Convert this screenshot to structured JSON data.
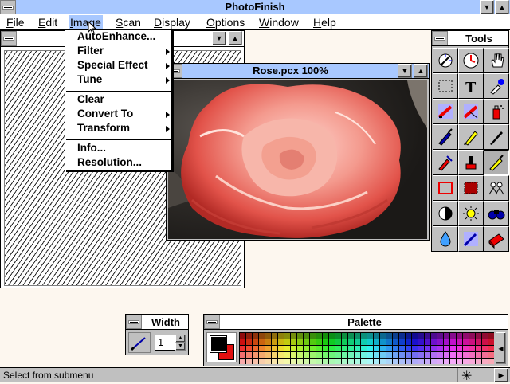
{
  "app": {
    "title": "PhotoFinish"
  },
  "menubar": [
    {
      "label": "File",
      "key": "F",
      "rest": "ile"
    },
    {
      "label": "Edit",
      "key": "E",
      "rest": "dit"
    },
    {
      "label": "Image",
      "key": "I",
      "rest": "mage"
    },
    {
      "label": "Scan",
      "key": "S",
      "rest": "can"
    },
    {
      "label": "Display",
      "key": "D",
      "rest": "isplay"
    },
    {
      "label": "Options",
      "key": "O",
      "rest": "ptions"
    },
    {
      "label": "Window",
      "key": "W",
      "rest": "indow"
    },
    {
      "label": "Help",
      "key": "H",
      "rest": "elp"
    }
  ],
  "image_menu": {
    "items": [
      {
        "label": "AutoEnhance..."
      },
      {
        "label": "Filter"
      },
      {
        "label": "Special Effect"
      },
      {
        "label": "Tune"
      },
      {
        "label": "Clear"
      },
      {
        "label": "Convert To"
      },
      {
        "label": "Transform"
      },
      {
        "label": "Info..."
      },
      {
        "label": "Resolution..."
      }
    ]
  },
  "rose_window": {
    "title": "Rose.pcx  100%"
  },
  "tools": {
    "title": "Tools"
  },
  "width_palette": {
    "title": "Width",
    "value": "1"
  },
  "color_palette": {
    "title": "Palette",
    "foreground": "#000000",
    "background": "#e01010"
  },
  "status": {
    "text": "Select from submenu"
  },
  "colors": {
    "title_active": "#a8c8ff",
    "face": "#c0c0c0",
    "desktop": "#fdf7ef"
  }
}
